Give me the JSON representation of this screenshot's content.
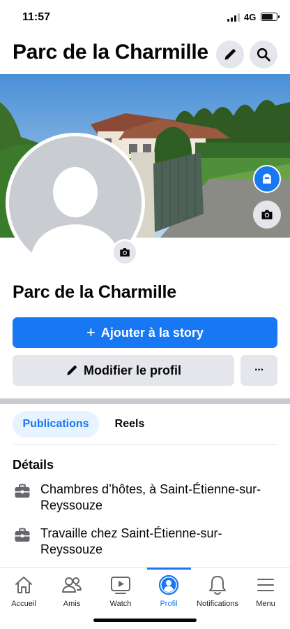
{
  "status_bar": {
    "time": "11:57",
    "network": "4G",
    "battery_level": 0.8
  },
  "header": {
    "title": "Parc de la Charmille",
    "edit_icon": "pencil-icon",
    "search_icon": "search-icon"
  },
  "profile": {
    "name": "Parc de la Charmille"
  },
  "actions": {
    "add_story_label": "Ajouter à la story",
    "edit_profile_label": "Modifier le profil",
    "more_label": "···"
  },
  "tabs": [
    {
      "label": "Publications",
      "active": true
    },
    {
      "label": "Reels",
      "active": false
    }
  ],
  "details": {
    "title": "Détails",
    "items": [
      {
        "icon": "briefcase-icon",
        "text": "Chambres d’hôtes, à Saint-Étienne-sur-Reyssouze"
      },
      {
        "icon": "briefcase-icon",
        "text": "Travaille chez Saint-Étienne-sur-Reyssouze"
      }
    ]
  },
  "bottom_nav": [
    {
      "label": "Accueil",
      "icon": "home-icon",
      "active": false
    },
    {
      "label": "Amis",
      "icon": "friends-icon",
      "active": false
    },
    {
      "label": "Watch",
      "icon": "watch-icon",
      "active": false
    },
    {
      "label": "Profil",
      "icon": "profile-icon",
      "active": true
    },
    {
      "label": "Notifications",
      "icon": "bell-icon",
      "active": false
    },
    {
      "label": "Menu",
      "icon": "menu-icon",
      "active": false
    }
  ],
  "colors": {
    "accent": "#1877f2",
    "light_accent": "#e7f3ff",
    "button_grey": "#e4e6eb",
    "text": "#050505"
  }
}
